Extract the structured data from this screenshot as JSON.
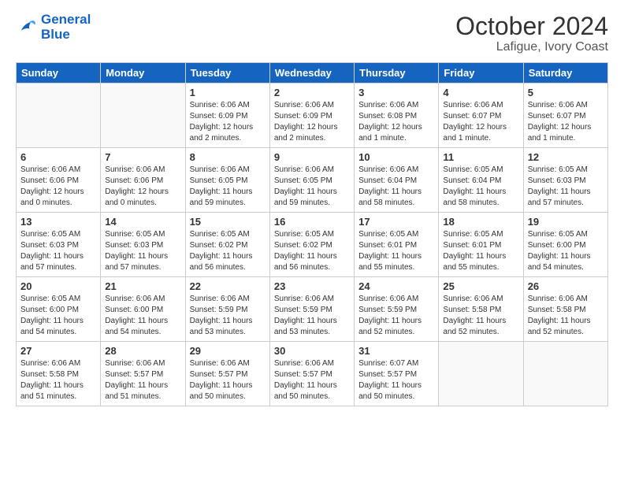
{
  "header": {
    "logo_line1": "General",
    "logo_line2": "Blue",
    "month": "October 2024",
    "location": "Lafigue, Ivory Coast"
  },
  "days_of_week": [
    "Sunday",
    "Monday",
    "Tuesday",
    "Wednesday",
    "Thursday",
    "Friday",
    "Saturday"
  ],
  "weeks": [
    [
      {
        "day": "",
        "info": ""
      },
      {
        "day": "",
        "info": ""
      },
      {
        "day": "1",
        "info": "Sunrise: 6:06 AM\nSunset: 6:09 PM\nDaylight: 12 hours\nand 2 minutes."
      },
      {
        "day": "2",
        "info": "Sunrise: 6:06 AM\nSunset: 6:09 PM\nDaylight: 12 hours\nand 2 minutes."
      },
      {
        "day": "3",
        "info": "Sunrise: 6:06 AM\nSunset: 6:08 PM\nDaylight: 12 hours\nand 1 minute."
      },
      {
        "day": "4",
        "info": "Sunrise: 6:06 AM\nSunset: 6:07 PM\nDaylight: 12 hours\nand 1 minute."
      },
      {
        "day": "5",
        "info": "Sunrise: 6:06 AM\nSunset: 6:07 PM\nDaylight: 12 hours\nand 1 minute."
      }
    ],
    [
      {
        "day": "6",
        "info": "Sunrise: 6:06 AM\nSunset: 6:06 PM\nDaylight: 12 hours\nand 0 minutes."
      },
      {
        "day": "7",
        "info": "Sunrise: 6:06 AM\nSunset: 6:06 PM\nDaylight: 12 hours\nand 0 minutes."
      },
      {
        "day": "8",
        "info": "Sunrise: 6:06 AM\nSunset: 6:05 PM\nDaylight: 11 hours\nand 59 minutes."
      },
      {
        "day": "9",
        "info": "Sunrise: 6:06 AM\nSunset: 6:05 PM\nDaylight: 11 hours\nand 59 minutes."
      },
      {
        "day": "10",
        "info": "Sunrise: 6:06 AM\nSunset: 6:04 PM\nDaylight: 11 hours\nand 58 minutes."
      },
      {
        "day": "11",
        "info": "Sunrise: 6:05 AM\nSunset: 6:04 PM\nDaylight: 11 hours\nand 58 minutes."
      },
      {
        "day": "12",
        "info": "Sunrise: 6:05 AM\nSunset: 6:03 PM\nDaylight: 11 hours\nand 57 minutes."
      }
    ],
    [
      {
        "day": "13",
        "info": "Sunrise: 6:05 AM\nSunset: 6:03 PM\nDaylight: 11 hours\nand 57 minutes."
      },
      {
        "day": "14",
        "info": "Sunrise: 6:05 AM\nSunset: 6:03 PM\nDaylight: 11 hours\nand 57 minutes."
      },
      {
        "day": "15",
        "info": "Sunrise: 6:05 AM\nSunset: 6:02 PM\nDaylight: 11 hours\nand 56 minutes."
      },
      {
        "day": "16",
        "info": "Sunrise: 6:05 AM\nSunset: 6:02 PM\nDaylight: 11 hours\nand 56 minutes."
      },
      {
        "day": "17",
        "info": "Sunrise: 6:05 AM\nSunset: 6:01 PM\nDaylight: 11 hours\nand 55 minutes."
      },
      {
        "day": "18",
        "info": "Sunrise: 6:05 AM\nSunset: 6:01 PM\nDaylight: 11 hours\nand 55 minutes."
      },
      {
        "day": "19",
        "info": "Sunrise: 6:05 AM\nSunset: 6:00 PM\nDaylight: 11 hours\nand 54 minutes."
      }
    ],
    [
      {
        "day": "20",
        "info": "Sunrise: 6:05 AM\nSunset: 6:00 PM\nDaylight: 11 hours\nand 54 minutes."
      },
      {
        "day": "21",
        "info": "Sunrise: 6:06 AM\nSunset: 6:00 PM\nDaylight: 11 hours\nand 54 minutes."
      },
      {
        "day": "22",
        "info": "Sunrise: 6:06 AM\nSunset: 5:59 PM\nDaylight: 11 hours\nand 53 minutes."
      },
      {
        "day": "23",
        "info": "Sunrise: 6:06 AM\nSunset: 5:59 PM\nDaylight: 11 hours\nand 53 minutes."
      },
      {
        "day": "24",
        "info": "Sunrise: 6:06 AM\nSunset: 5:59 PM\nDaylight: 11 hours\nand 52 minutes."
      },
      {
        "day": "25",
        "info": "Sunrise: 6:06 AM\nSunset: 5:58 PM\nDaylight: 11 hours\nand 52 minutes."
      },
      {
        "day": "26",
        "info": "Sunrise: 6:06 AM\nSunset: 5:58 PM\nDaylight: 11 hours\nand 52 minutes."
      }
    ],
    [
      {
        "day": "27",
        "info": "Sunrise: 6:06 AM\nSunset: 5:58 PM\nDaylight: 11 hours\nand 51 minutes."
      },
      {
        "day": "28",
        "info": "Sunrise: 6:06 AM\nSunset: 5:57 PM\nDaylight: 11 hours\nand 51 minutes."
      },
      {
        "day": "29",
        "info": "Sunrise: 6:06 AM\nSunset: 5:57 PM\nDaylight: 11 hours\nand 50 minutes."
      },
      {
        "day": "30",
        "info": "Sunrise: 6:06 AM\nSunset: 5:57 PM\nDaylight: 11 hours\nand 50 minutes."
      },
      {
        "day": "31",
        "info": "Sunrise: 6:07 AM\nSunset: 5:57 PM\nDaylight: 11 hours\nand 50 minutes."
      },
      {
        "day": "",
        "info": ""
      },
      {
        "day": "",
        "info": ""
      }
    ]
  ]
}
